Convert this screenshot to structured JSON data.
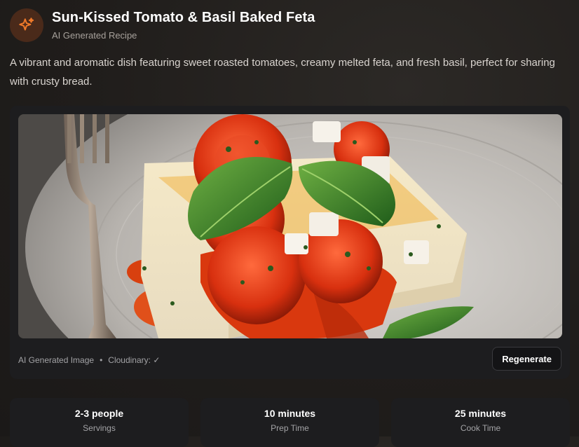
{
  "header": {
    "title": "Sun-Kissed Tomato & Basil Baked Feta",
    "subtitle": "AI Generated Recipe",
    "icon": "sparkles-icon",
    "accent_color": "#f07a2a"
  },
  "description": "A vibrant and aromatic dish featuring sweet roasted tomatoes, creamy melted feta, and fresh basil, perfect for sharing with crusty bread.",
  "image_card": {
    "image_alt": "Baked feta with roasted tomatoes and basil",
    "caption": "AI Generated Image",
    "separator": "•",
    "storage_status": "Cloudinary: ✓",
    "regenerate_label": "Regenerate"
  },
  "stats": [
    {
      "value": "2-3 people",
      "label": "Servings"
    },
    {
      "value": "10 minutes",
      "label": "Prep Time"
    },
    {
      "value": "25 minutes",
      "label": "Cook Time"
    }
  ]
}
